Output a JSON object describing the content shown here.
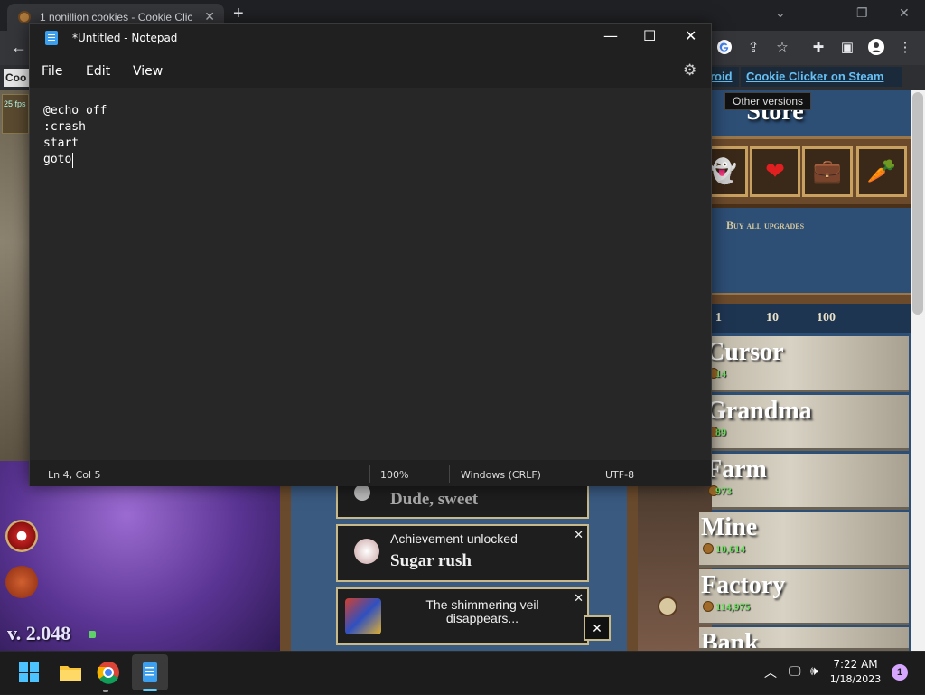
{
  "browser": {
    "tab_title": "1 nonillion cookies - Cookie Clic",
    "tab_close": "✕",
    "new_tab": "+",
    "back": "←"
  },
  "page": {
    "top_left_label": "Coo",
    "android_link_fragment": "roid",
    "steam_link": "Cookie Clicker on Steam",
    "other_versions_tooltip": "Other versions",
    "version": "v. 2.048"
  },
  "store": {
    "title": "Store",
    "buy_all": "Buy all upgrades",
    "bulk": [
      "1",
      "10",
      "100"
    ],
    "upgrades": [
      "👻",
      "❤",
      "💼",
      "🥕"
    ],
    "buildings": [
      {
        "name": "Cursor",
        "cost": "14"
      },
      {
        "name": "Grandma",
        "cost": "89"
      },
      {
        "name": "Farm",
        "cost": "973"
      },
      {
        "name": "Mine",
        "cost": "10,614"
      },
      {
        "name": "Factory",
        "cost": "114,975"
      },
      {
        "name": "Bank",
        "cost": ""
      }
    ]
  },
  "notifications": [
    {
      "title": "",
      "name": "Dude, sweet"
    },
    {
      "title": "Achievement unlocked",
      "name": "Sugar rush"
    },
    {
      "title": "The shimmering veil disappears...",
      "name": ""
    }
  ],
  "notepad": {
    "title": "*Untitled - Notepad",
    "menu": [
      "File",
      "Edit",
      "View"
    ],
    "content": "@echo off\n:crash\nstart\ngoto",
    "status": {
      "position": "Ln 4, Col 5",
      "zoom": "100%",
      "line_ending": "Windows (CRLF)",
      "encoding": "UTF-8"
    }
  },
  "taskbar": {
    "time": "7:22 AM",
    "date": "1/18/2023",
    "notification_count": "1"
  },
  "colors": {
    "accent": "#60cdff",
    "cost_green": "#6ee060",
    "store_blue": "#2d4e75"
  }
}
